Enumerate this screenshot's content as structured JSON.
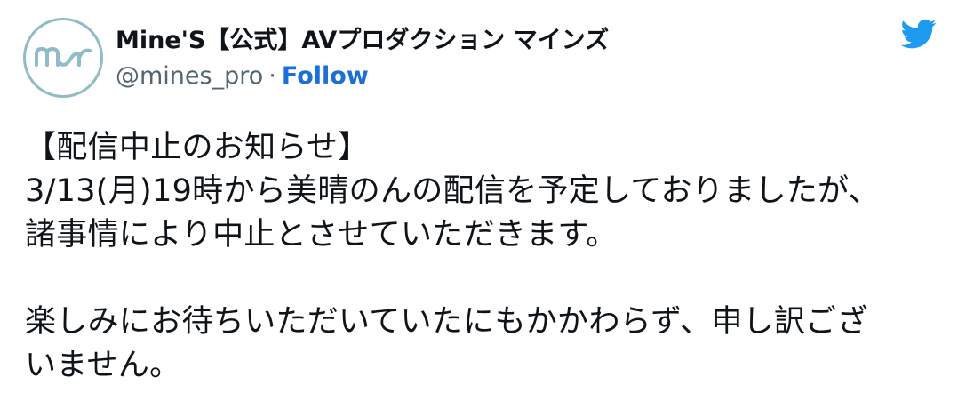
{
  "tweet": {
    "author": {
      "display_name": "Mine'S【公式】AVプロダクション マインズ",
      "handle": "@mines_pro",
      "separator": "·",
      "follow_label": "Follow",
      "avatar_icon": "mines-logo-icon"
    },
    "brand_icon": "twitter-bird-icon",
    "colors": {
      "follow_link": "#1d6fd8",
      "twitter_blue": "#1d9bf0",
      "avatar_logo": "#8fbcc6",
      "handle_gray": "#536471"
    },
    "body_lines": [
      "【配信中止のお知らせ】",
      "3/13(月)19時から美晴のんの配信を予定しておりましたが、",
      "諸事情により中止とさせていただきます。",
      "",
      "楽しみにお待ちいただいていたにもかかわらず、申し訳ござ",
      "いません。"
    ]
  }
}
